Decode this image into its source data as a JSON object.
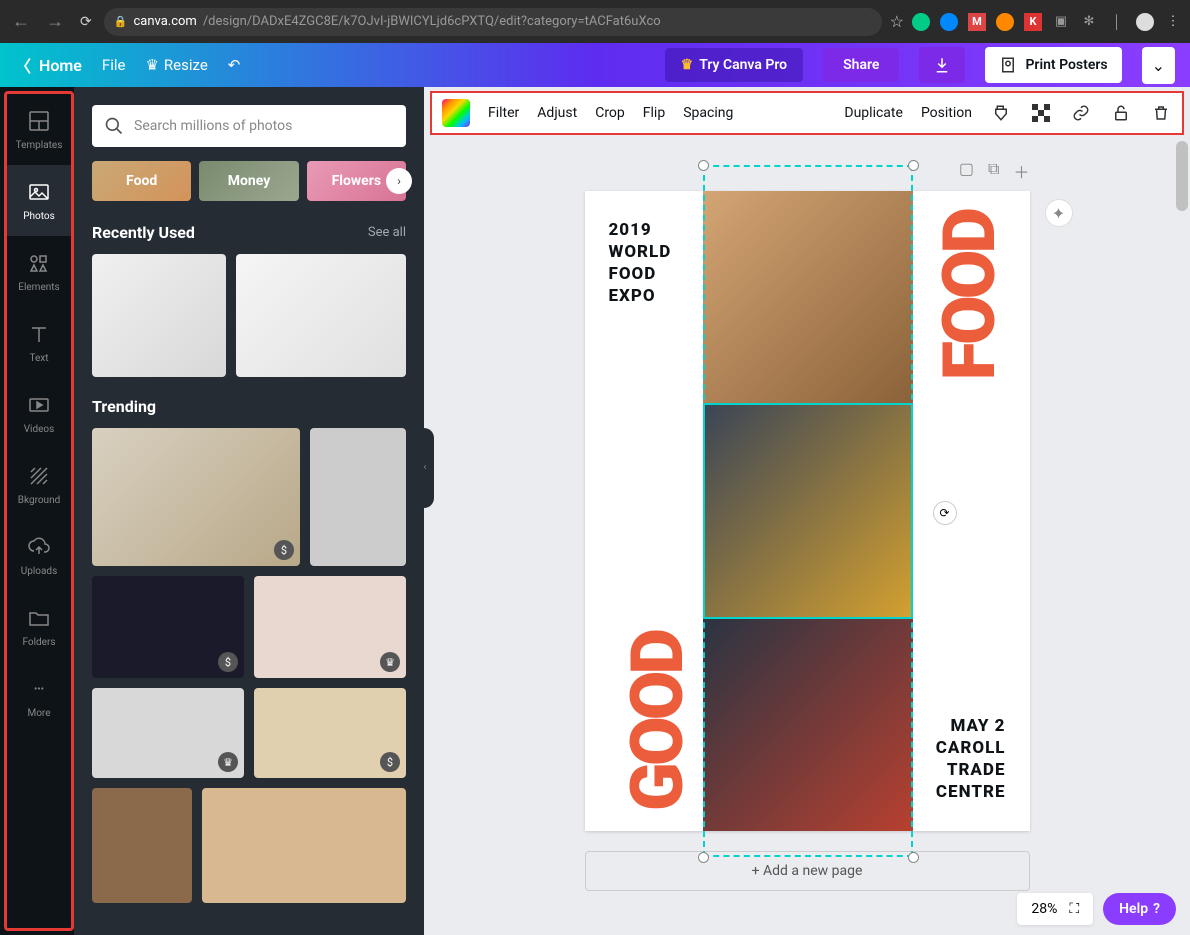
{
  "browser": {
    "url_domain": "canva.com",
    "url_path": "/design/DADxE4ZGC8E/k7OJvI-jBWICYLjd6cPXTQ/edit?category=tACFat6uXco"
  },
  "topnav": {
    "home": "Home",
    "file": "File",
    "resize": "Resize",
    "try_pro": "Try Canva Pro",
    "share": "Share",
    "print": "Print Posters"
  },
  "rail": {
    "templates": "Templates",
    "photos": "Photos",
    "elements": "Elements",
    "text": "Text",
    "videos": "Videos",
    "bkground": "Bkground",
    "uploads": "Uploads",
    "folders": "Folders",
    "more": "More"
  },
  "panel": {
    "search_placeholder": "Search millions of photos",
    "chips": {
      "food": "Food",
      "money": "Money",
      "flowers": "Flowers"
    },
    "recently_used": "Recently Used",
    "see_all": "See all",
    "trending": "Trending"
  },
  "toolbar": {
    "filter": "Filter",
    "adjust": "Adjust",
    "crop": "Crop",
    "flip": "Flip",
    "spacing": "Spacing",
    "duplicate": "Duplicate",
    "position": "Position"
  },
  "poster": {
    "line1": "2019",
    "line2": "WORLD",
    "line3": "FOOD",
    "line4": "EXPO",
    "v1": "FOOD",
    "v2": "GOOD",
    "b1": "MAY 2",
    "b2": "CAROLL",
    "b3": "TRADE",
    "b4": "CENTRE"
  },
  "canvas": {
    "add_page": "+ Add a new page",
    "zoom": "28%"
  },
  "help": "Help"
}
